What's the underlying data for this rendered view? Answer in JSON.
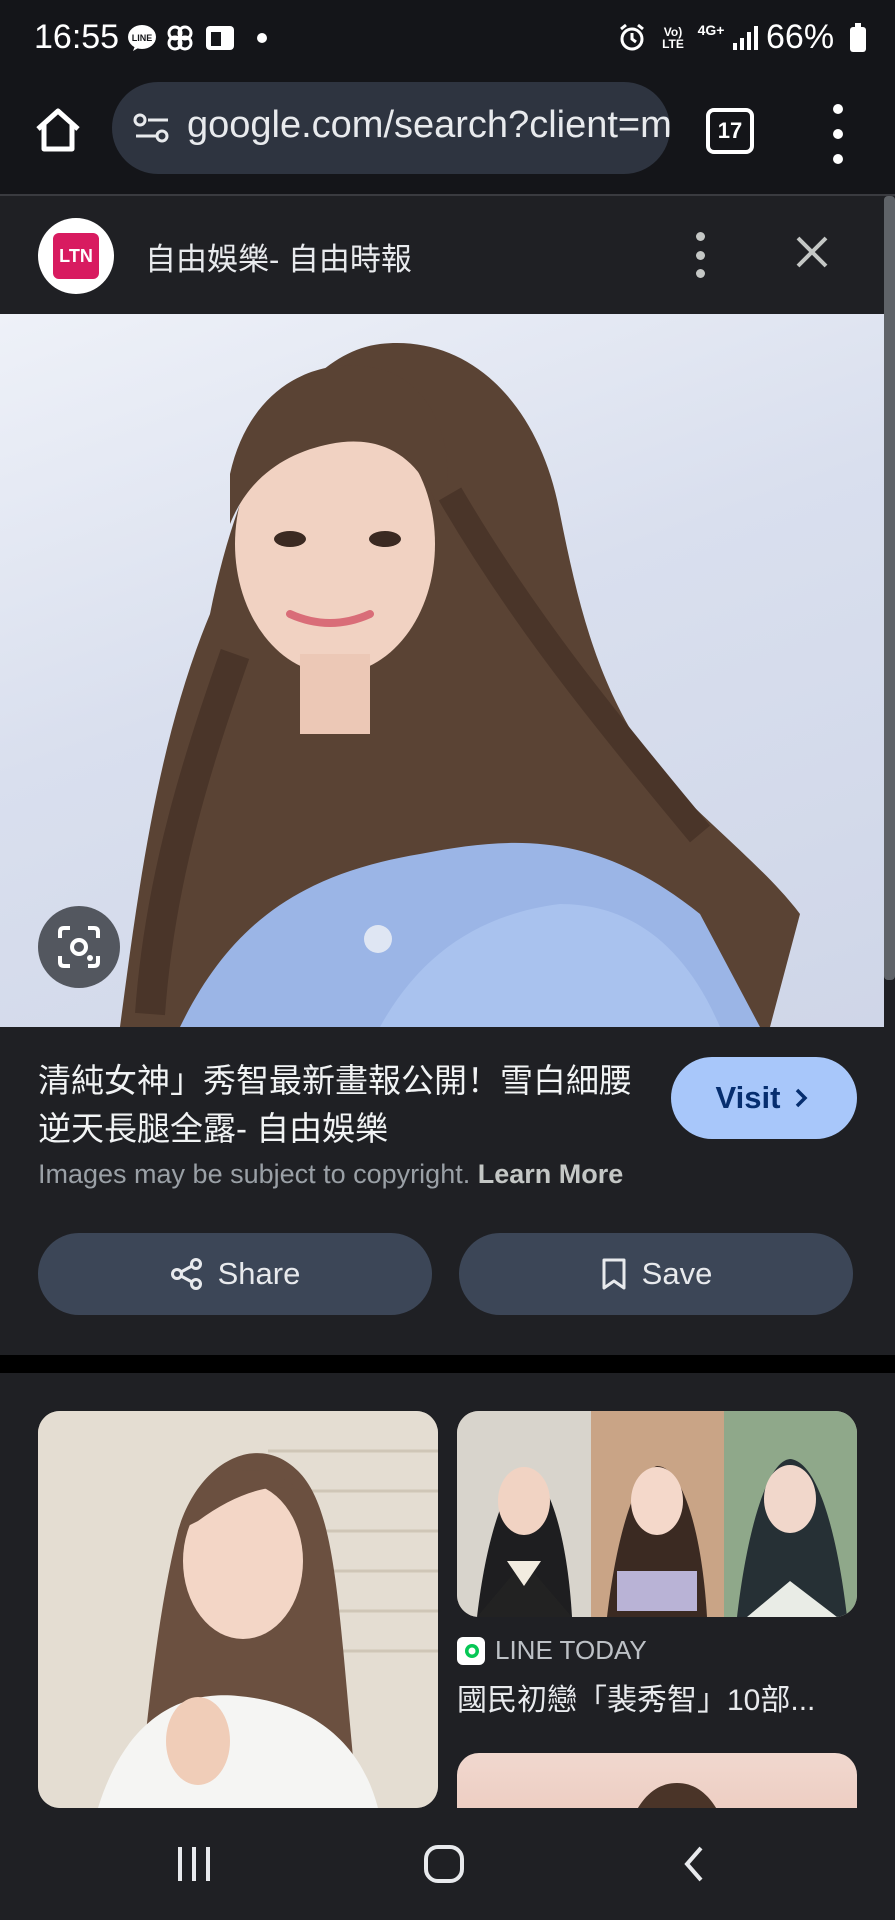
{
  "status_bar": {
    "time": "16:55",
    "battery_percent": "66%",
    "network": "4G+",
    "volte": "Vo) LTE",
    "left_icons": [
      "line-icon",
      "pinwheel-icon",
      "flipboard-icon",
      "dot-icon"
    ],
    "right_icons": [
      "alarm-icon",
      "volte-icon",
      "4g-icon",
      "signal-icon",
      "battery-icon"
    ]
  },
  "toolbar": {
    "url": "google.com/search?client=m",
    "tab_count": "17"
  },
  "source": {
    "logo_text": "LTN",
    "title": "自由娛樂- 自由時報",
    "logo_color": "#d81b60"
  },
  "image_result": {
    "title": "清純女神」秀智最新畫報公開！雪白細腰逆天長腿全露- 自由娛樂",
    "visit_label": "Visit",
    "copyright_text": "Images may be subject to copyright.",
    "learn_more": "Learn More",
    "share_label": "Share",
    "save_label": "Save"
  },
  "related": {
    "item2_source": "LINE TODAY",
    "item2_title": "國民初戀「裴秀智」10部..."
  },
  "colors": {
    "accent": "#a8c7fa",
    "pill": "#3c4657",
    "background": "#1f2024"
  }
}
